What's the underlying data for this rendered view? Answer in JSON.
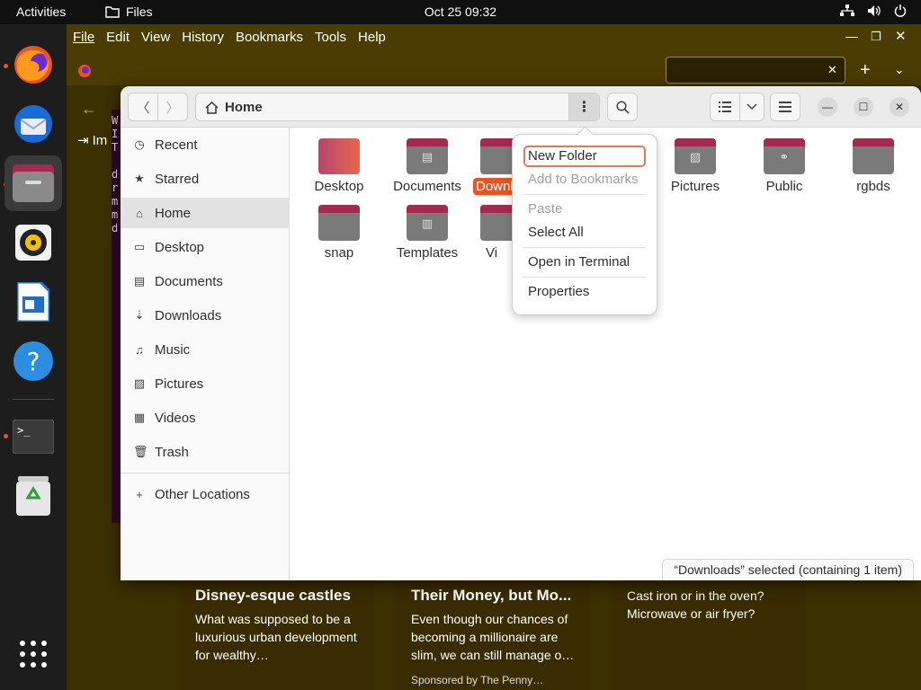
{
  "topbar": {
    "activities": "Activities",
    "app_name": "Files",
    "clock": "Oct 25  09:32"
  },
  "dock": {
    "items": [
      "firefox-icon",
      "thunderbird-icon",
      "files-icon",
      "rhythmbox-icon",
      "libreoffice-writer-icon",
      "help-icon",
      "terminal-icon",
      "trash-icon",
      "app-grid-icon"
    ]
  },
  "firefox": {
    "menu": [
      "File",
      "Edit",
      "View",
      "History",
      "Bookmarks",
      "Tools",
      "Help"
    ],
    "toolbar_label": "Im",
    "terminal_chars": [
      "W",
      "I",
      "T",
      "",
      "d",
      "r",
      "m",
      "m",
      "d"
    ],
    "cards": [
      {
        "title": "Disney-esque castles",
        "body": "What was supposed to be a luxurious urban development for wealthy…",
        "sponsor": ""
      },
      {
        "title": "Their Money, but Mo...",
        "body": "Even though our chances of becoming a millionaire are slim, we can still manage o…",
        "sponsor": "Sponsored by The Penny…"
      },
      {
        "title": "",
        "body": "Cast iron or in the oven? Microwave or air fryer?",
        "sponsor": ""
      }
    ]
  },
  "files": {
    "location": "Home",
    "sidebar": [
      {
        "label": "Recent",
        "icon": "clock-icon"
      },
      {
        "label": "Starred",
        "icon": "star-icon"
      },
      {
        "label": "Home",
        "icon": "home-icon"
      },
      {
        "label": "Desktop",
        "icon": "desktop-icon"
      },
      {
        "label": "Documents",
        "icon": "document-icon"
      },
      {
        "label": "Downloads",
        "icon": "download-icon"
      },
      {
        "label": "Music",
        "icon": "music-icon"
      },
      {
        "label": "Pictures",
        "icon": "picture-icon"
      },
      {
        "label": "Videos",
        "icon": "video-icon"
      },
      {
        "label": "Trash",
        "icon": "trash-icon"
      }
    ],
    "other_locations": "Other Locations",
    "folders": [
      {
        "label": "Desktop"
      },
      {
        "label": "Documents"
      },
      {
        "label": "Downl"
      },
      {
        "label": "Pictures"
      },
      {
        "label": "Public"
      },
      {
        "label": "rgbds"
      },
      {
        "label": "snap"
      },
      {
        "label": "Templates"
      },
      {
        "label": "Vi"
      }
    ],
    "status": "“Downloads” selected  (containing 1 item)"
  },
  "popover": {
    "items": {
      "new_folder": "New Folder",
      "add_bookmarks": "Add to Bookmarks",
      "paste": "Paste",
      "select_all": "Select All",
      "open_terminal": "Open in Terminal",
      "properties": "Properties"
    }
  }
}
